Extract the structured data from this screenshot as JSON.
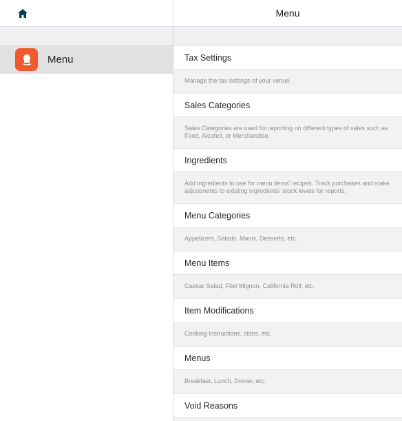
{
  "sidebar": {
    "home_icon": "home-icon",
    "items": [
      {
        "label": "Menu",
        "icon": "menu-chef-icon",
        "icon_color": "#ef5a2e",
        "selected": true
      }
    ]
  },
  "main": {
    "title": "Menu",
    "sections": [
      {
        "title": "Tax Settings",
        "description": "Manage the tax settings of your venue."
      },
      {
        "title": "Sales Categories",
        "description": "Sales Categories are used for reporting on different types of sales such as Food, Alcohol, or Merchandise."
      },
      {
        "title": "Ingredients",
        "description": "Add ingredients to use for menu items' recipes. Track purchases and make adjustments to existing ingredients' stock levels for reports."
      },
      {
        "title": "Menu Categories",
        "description": "Appetizers, Salads, Mains, Desserts, etc."
      },
      {
        "title": "Menu Items",
        "description": "Caesar Salad, Filet Mignon, California Roll, etc."
      },
      {
        "title": "Item Modifications",
        "description": "Cooking instructions, sides, etc."
      },
      {
        "title": "Menus",
        "description": "Breakfast, Lunch, Dinner, etc."
      },
      {
        "title": "Void Reasons",
        "description": ""
      }
    ]
  }
}
